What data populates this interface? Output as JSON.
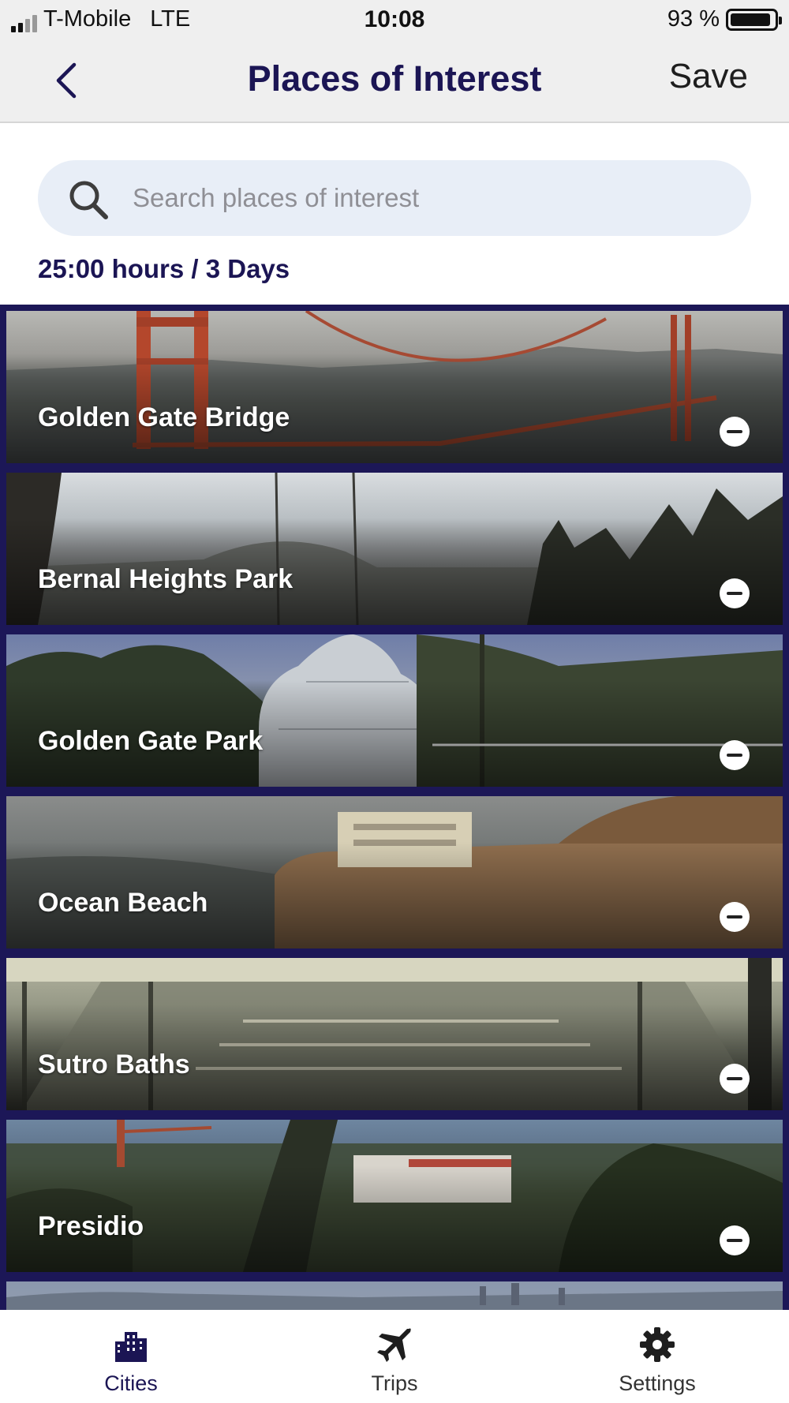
{
  "status_bar": {
    "carrier": "T-Mobile",
    "network": "LTE",
    "time": "10:08",
    "battery_text": "93 %",
    "battery_level": 0.93
  },
  "nav": {
    "title": "Places of Interest",
    "save_label": "Save",
    "back_icon": "chevron-left-icon"
  },
  "search": {
    "placeholder": "Search places of interest",
    "value": "",
    "icon": "search-icon"
  },
  "summary": "25:00 hours / 3 Days",
  "places": [
    {
      "name": "Golden Gate Bridge",
      "remove_icon": "minus-circle-icon"
    },
    {
      "name": "Bernal Heights Park",
      "remove_icon": "minus-circle-icon"
    },
    {
      "name": "Golden Gate Park",
      "remove_icon": "minus-circle-icon"
    },
    {
      "name": "Ocean Beach",
      "remove_icon": "minus-circle-icon"
    },
    {
      "name": "Sutro Baths",
      "remove_icon": "minus-circle-icon"
    },
    {
      "name": "Presidio",
      "remove_icon": "minus-circle-icon"
    }
  ],
  "tabs": [
    {
      "label": "Cities",
      "icon": "city-buildings-icon",
      "active": true
    },
    {
      "label": "Trips",
      "icon": "airplane-icon",
      "active": false
    },
    {
      "label": "Settings",
      "icon": "gear-icon",
      "active": false
    }
  ],
  "colors": {
    "brand_navy": "#1b1554",
    "list_background": "#1c1757",
    "search_background": "#e8eef7",
    "nav_background": "#efefef"
  }
}
